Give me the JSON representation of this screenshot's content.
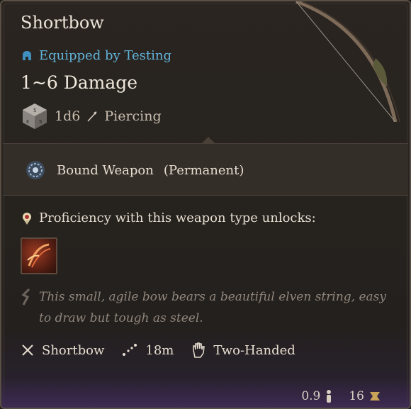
{
  "item": {
    "name": "Shortbow",
    "equipped_text": "Equipped by Testing",
    "damage": "1~6 Damage",
    "dice": "1d6",
    "damage_type": "Piercing"
  },
  "passive": {
    "name": "Bound Weapon",
    "duration": "(Permanent)"
  },
  "proficiency": {
    "text": "Proficiency with this weapon type unlocks:"
  },
  "description": "This small, agile bow bears a beautiful elven string, easy to draw but tough as steel.",
  "properties": {
    "type": "Shortbow",
    "range": "18m",
    "handedness": "Two-Handed"
  },
  "footer": {
    "weight": "0.9",
    "value": "16"
  },
  "icons": [
    "helmet-icon",
    "dice-icon",
    "arrow-icon",
    "bound-weapon-icon",
    "proficiency-icon",
    "skill-icon",
    "description-icon",
    "crossed-weapons-icon",
    "range-icon",
    "hand-icon",
    "weight-icon",
    "value-icon"
  ]
}
